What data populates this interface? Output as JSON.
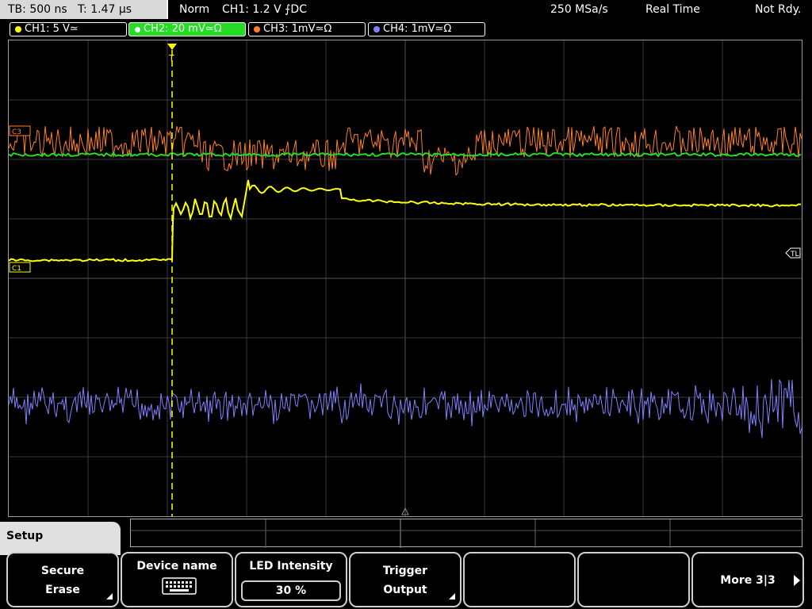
{
  "status": {
    "timebase": "TB: 500 ns",
    "trigger_time": "T: 1.47 µs",
    "mode": "Norm",
    "trigger_setting": "CH1: 1.2 V ⨍DC",
    "sample_rate": "250 MSa/s",
    "acquisition": "Real Time",
    "state": "Not Rdy."
  },
  "channels": [
    {
      "label": "CH1: 5 V≃",
      "color": "#ffff00"
    },
    {
      "label": "CH2: 20 mV≃Ω",
      "color": "#22dd22"
    },
    {
      "label": "CH3: 1mV≃Ω",
      "color": "#ff7f2a"
    },
    {
      "label": "CH4: 1mV≃Ω",
      "color": "#8080ff"
    }
  ],
  "markers": {
    "c3": "C3",
    "c1": "C1",
    "tl": "TL",
    "trigger": "T"
  },
  "menu": {
    "title": "Setup",
    "keys": [
      {
        "line1": "Secure",
        "line2": "Erase"
      },
      {
        "line1": "Device name",
        "icon": "keyboard-icon"
      },
      {
        "line1": "LED Intensity",
        "value": "30 %"
      },
      {
        "line1": "Trigger",
        "line2": "Output"
      },
      {
        "line1": ""
      },
      {
        "line1": ""
      },
      {
        "line1": "More 3|3"
      }
    ]
  }
}
